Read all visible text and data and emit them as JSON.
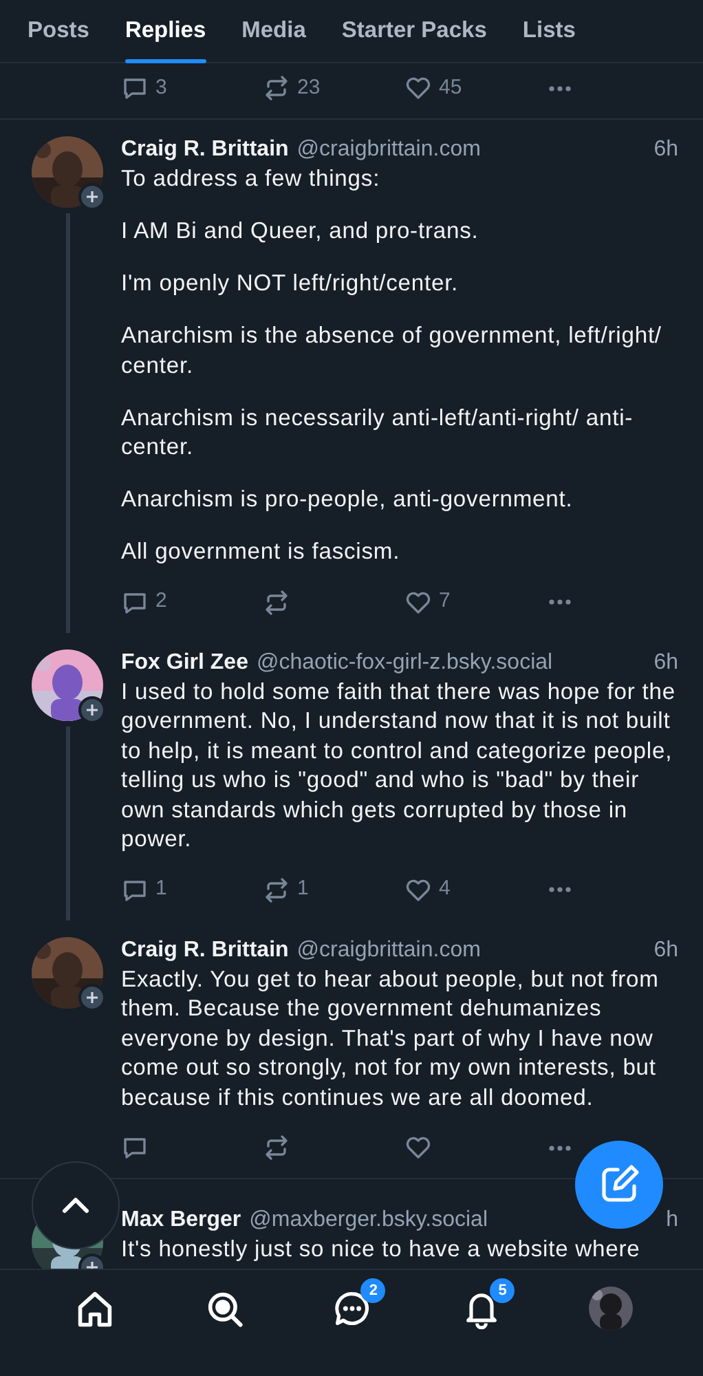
{
  "tabs": [
    {
      "label": "Posts",
      "selected": false
    },
    {
      "label": "Replies",
      "selected": true
    },
    {
      "label": "Media",
      "selected": false
    },
    {
      "label": "Starter Packs",
      "selected": false
    },
    {
      "label": "Lists",
      "selected": false
    }
  ],
  "previous_post_actions": {
    "replies": "3",
    "reposts": "23",
    "likes": "45"
  },
  "posts": [
    {
      "name": "Craig R. Brittain",
      "handle": "@craigbrittain.com",
      "time": "6h",
      "thread_below": true,
      "actions_shown": true,
      "paragraphs": [
        "To address a few things:",
        "I AM Bi and Queer, and pro-trans.",
        "I'm openly NOT left/right/center.",
        "Anarchism is the absence of government, left/right/ center.",
        "Anarchism is necessarily anti-left/anti-right/ anti-center.",
        "Anarchism is pro-people, anti-government.",
        "All government is fascism."
      ],
      "replies": "2",
      "likes": "7"
    },
    {
      "name": "Fox Girl Zee",
      "handle": "@chaotic-fox-girl-z.bsky.social",
      "time": "6h",
      "thread_below": true,
      "actions_shown": true,
      "paragraphs": [
        "I used to hold some faith that there was hope for the government. No, I understand now that it is not built to help, it is meant to control and categorize people, telling us who is \"good\" and who is \"bad\" by their own standards which gets corrupted by those in power."
      ],
      "replies": "1",
      "reposts": "1",
      "likes": "4"
    },
    {
      "name": "Craig R. Brittain",
      "handle": "@craigbrittain.com",
      "time": "6h",
      "thread_below": false,
      "actions_shown": true,
      "paragraphs": [
        "Exactly. You get to hear about people, but not from them. Because the government dehumanizes everyone by design. That's part of why I have now come out so strongly, not for my own interests, but because if this continues we are all doomed."
      ]
    },
    {
      "name": "Max Berger",
      "handle": "@maxberger.bsky.social",
      "time": "h",
      "thread_below": false,
      "paragraphs": [
        "It's honestly just so nice to have a website where"
      ]
    }
  ],
  "nav": [
    {
      "kind": "home"
    },
    {
      "kind": "search"
    },
    {
      "kind": "chat",
      "badge": "2"
    },
    {
      "kind": "bell",
      "badge": "5"
    },
    {
      "kind": "profile"
    }
  ]
}
